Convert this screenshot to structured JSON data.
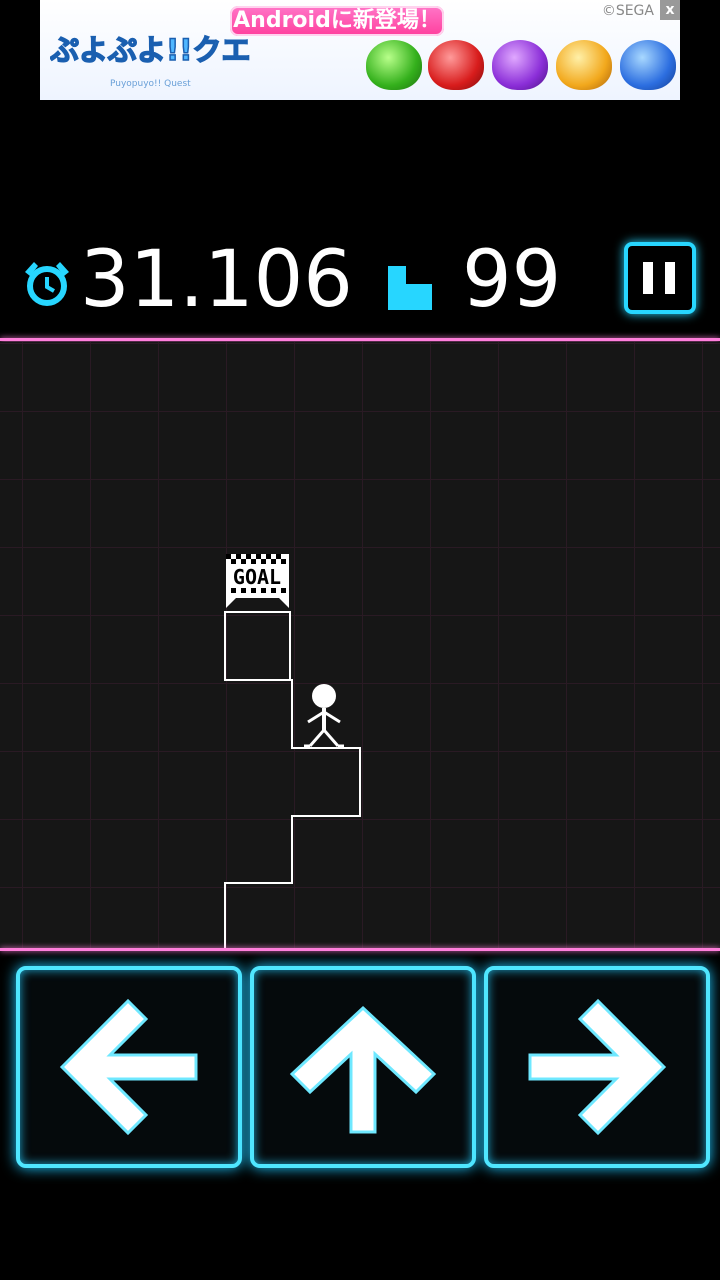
{
  "ad": {
    "title": "ぷよぷよ!!クエスト",
    "headline": "Androidに新登場！",
    "copyright": "©SEGA",
    "subtitle": "Puyopuyo!! Quest",
    "close": "x"
  },
  "hud": {
    "timer_icon": "alarm-clock-icon",
    "time": "31.106",
    "block_icon": "block-icon",
    "count": "99",
    "pause_icon": "pause-icon"
  },
  "level": {
    "goal_label": "GOAL"
  },
  "controls": {
    "left_icon": "arrow-left-icon",
    "up_icon": "arrow-up-icon",
    "right_icon": "arrow-right-icon"
  },
  "colors": {
    "accent": "#27d6ff",
    "divider": "#ff7fdc",
    "board_bg": "#161616",
    "grid_line": "#2a1a24"
  }
}
